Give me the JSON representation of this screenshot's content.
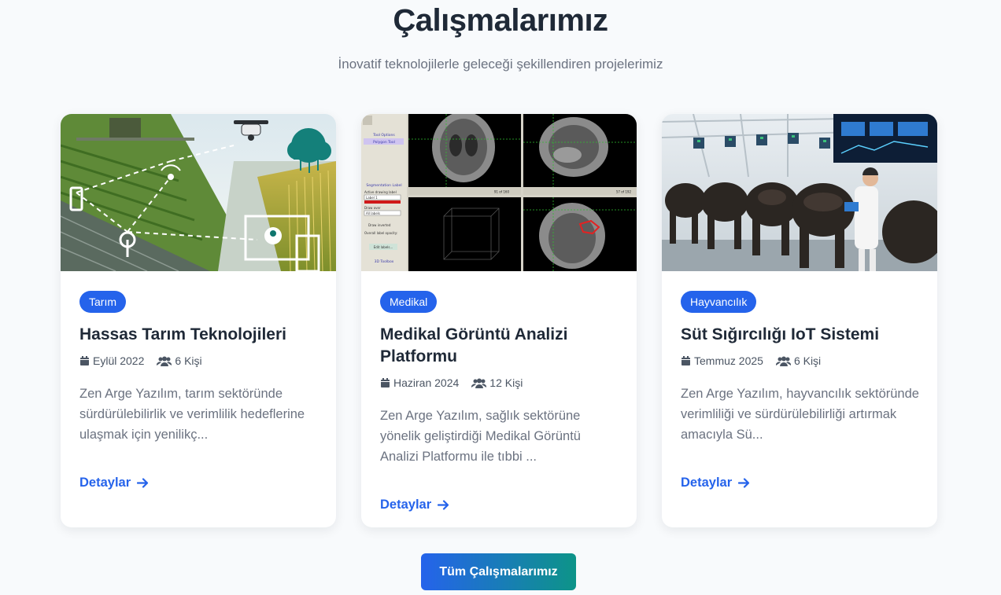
{
  "header": {
    "title": "Çalışmalarımız",
    "subtitle": "İnovatif teknolojilerle geleceği şekillendiren projelerimiz"
  },
  "projects": [
    {
      "badge": "Tarım",
      "title": "Hassas Tarım Teknolojileri",
      "date": "Eylül 2022",
      "team": "6 Kişi",
      "description": "Zen Arge Yazılım, tarım sektöründe sürdürülebilirlik ve verimlilik hedeflerine ulaşmak için yenilikç...",
      "link": "Detaylar"
    },
    {
      "badge": "Medikal",
      "title": "Medikal Görüntü Analizi Platformu",
      "date": "Haziran 2024",
      "team": "12 Kişi",
      "description": "Zen Arge Yazılım, sağlık sektörüne yönelik geliştirdiği Medikal Görüntü Analizi Platformu ile tıbbi ...",
      "link": "Detaylar"
    },
    {
      "badge": "Hayvancılık",
      "title": "Süt Sığırcılığı IoT Sistemi",
      "date": "Temmuz 2025",
      "team": "6 Kişi",
      "description": "Zen Arge Yazılım, hayvancılık sektöründe verimliliği ve sürdürülebilirliği artırmak amacıyla Sü...",
      "link": "Detaylar"
    }
  ],
  "footer": {
    "button_label": "Tüm Çalışmalarımız"
  },
  "medical_image_panel": {
    "tool_options": "Tool Options",
    "polygon_tool": "Polygon Tool",
    "segmentation_label": "Segmentation Label",
    "active_label": "Active drawing label",
    "label_value": "Label 1",
    "draw_over": "Draw over",
    "all_labels": "All labels",
    "draw_inverted": "Draw inverted",
    "overall_opacity": "Overall label opacity:",
    "edit_labels": "Edit labels...",
    "toolbox": "3D Toolbox",
    "slice_a": "91 of 160",
    "slice_b": "57 of 192"
  },
  "colors": {
    "accent": "#2563eb",
    "gradient_end": "#0d9488",
    "title": "#1f2937",
    "muted": "#6b7280"
  }
}
